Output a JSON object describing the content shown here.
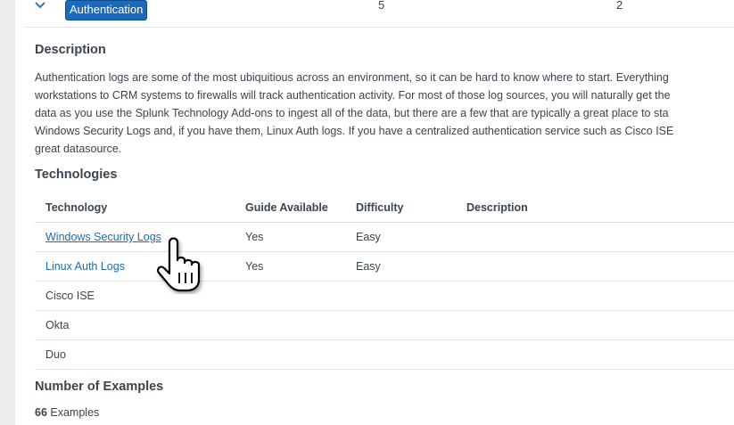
{
  "category_row": {
    "label": "Authentication",
    "count_a": "5",
    "count_b": "2"
  },
  "description": {
    "title": "Description",
    "lines": [
      "Authentication logs are some of the most ubiquitious across an environment, so it can be hard to know where to start. Everything",
      "workstations to CRM systems to firewalls will track authentication activity. For most of those log sources, you will naturally get the",
      "data as you use the Splunk Technology Add-ons to ingest all of the data, but there are a few that are typically a great place to sta",
      "Windows Security Logs and, if you have them, Linux Auth logs. If you have a centralized authentication service such as Cisco ISE",
      "great datasource."
    ]
  },
  "technologies": {
    "title": "Technologies",
    "headers": {
      "technology": "Technology",
      "guide": "Guide Available",
      "difficulty": "Difficulty",
      "description": "Description"
    },
    "rows": [
      {
        "technology": "Windows Security Logs",
        "guide": "Yes",
        "difficulty": "Easy",
        "description": ""
      },
      {
        "technology": "Linux Auth Logs",
        "guide": "Yes",
        "difficulty": "Easy",
        "description": ""
      },
      {
        "technology": "Cisco ISE",
        "guide": "",
        "difficulty": "",
        "description": ""
      },
      {
        "technology": "Okta",
        "guide": "",
        "difficulty": "",
        "description": ""
      },
      {
        "technology": "Duo",
        "guide": "",
        "difficulty": "",
        "description": ""
      }
    ]
  },
  "examples": {
    "title": "Number of Examples",
    "count": "66",
    "unit": "Examples"
  },
  "colors": {
    "accent": "#1a6bbd",
    "text": "#3c444d",
    "divider": "#e1e6eb"
  },
  "icons": {
    "expand": "chevron-down-icon",
    "pointer": "hand-pointer-cursor-icon"
  }
}
